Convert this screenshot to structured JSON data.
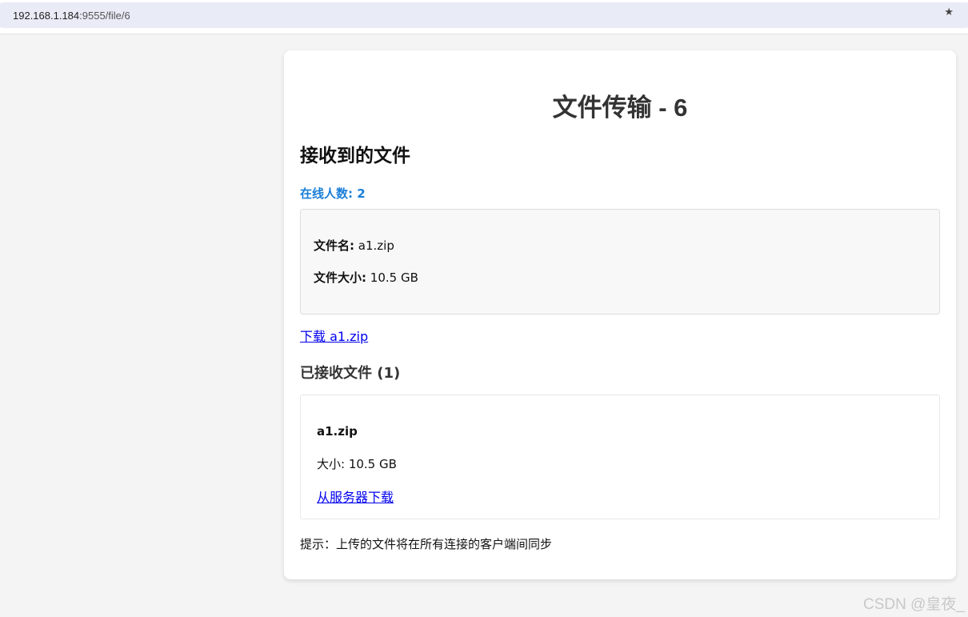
{
  "browser": {
    "address_host": "192.168.1.184",
    "address_rest": ":9555/file/6",
    "bookmark_icon": "star-icon"
  },
  "page": {
    "title": "文件传输 - 6",
    "section_title": "接收到的文件",
    "online_label": "在线人数: 2",
    "file_info": {
      "name_label": "文件名:",
      "name_value": "a1.zip",
      "size_label": "文件大小:",
      "size_value": "10.5 GB"
    },
    "download_link": "下载 a1.zip",
    "received_title": "已接收文件 (1)",
    "received_files": [
      {
        "name": "a1.zip",
        "size": "大小: 10.5 GB",
        "link": "从服务器下载"
      }
    ],
    "hint": "提示：上传的文件将在所有连接的客户端间同步"
  },
  "watermark": "CSDN @皇夜_",
  "colors": {
    "online": "#1a7fd9",
    "link": "#0000ee",
    "background": "#f4f4f4",
    "card": "#ffffff"
  }
}
